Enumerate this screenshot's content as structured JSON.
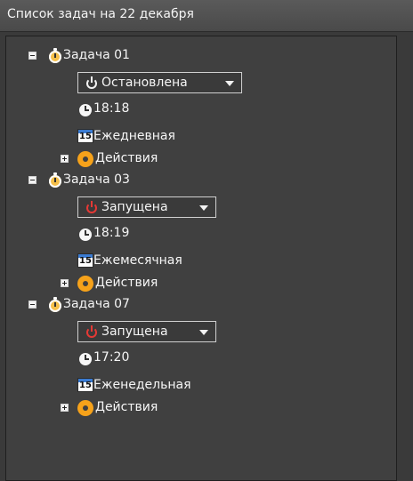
{
  "header": {
    "title": "Список задач на 22 декабря"
  },
  "colors": {
    "stopped_icon": "#f2f2f2",
    "running_icon": "#e53935",
    "accent_gear": "#f6a21a",
    "calendar_top": "#3b7bd1"
  },
  "tasks": [
    {
      "name": "Задача 01",
      "status": "Остановлена",
      "status_kind": "stopped",
      "time": "18:18",
      "schedule": "Ежедневная",
      "calendar_day": "15",
      "actions_label": "Действия"
    },
    {
      "name": "Задача 03",
      "status": "Запущена",
      "status_kind": "running",
      "time": "18:19",
      "schedule": "Ежемесячная",
      "calendar_day": "15",
      "actions_label": "Действия"
    },
    {
      "name": "Задача 07",
      "status": "Запущена",
      "status_kind": "running",
      "time": "17:20",
      "schedule": "Еженедельная",
      "calendar_day": "15",
      "actions_label": "Действия"
    }
  ]
}
